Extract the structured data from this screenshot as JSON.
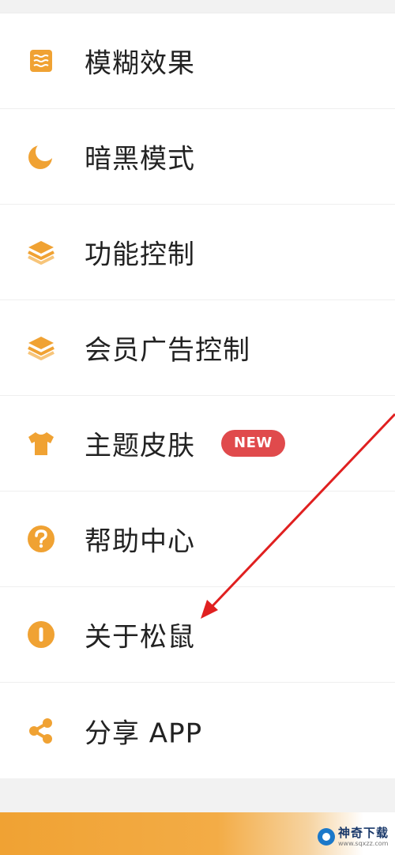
{
  "menu": {
    "items": [
      {
        "label": "模糊效果",
        "icon": "blur-icon"
      },
      {
        "label": "暗黑模式",
        "icon": "moon-icon"
      },
      {
        "label": "功能控制",
        "icon": "layers-icon"
      },
      {
        "label": "会员广告控制",
        "icon": "layers-icon"
      },
      {
        "label": "主题皮肤",
        "icon": "tshirt-icon",
        "badge": "NEW"
      },
      {
        "label": "帮助中心",
        "icon": "question-icon"
      },
      {
        "label": "关于松鼠",
        "icon": "info-icon"
      },
      {
        "label": "分享 APP",
        "icon": "share-icon"
      }
    ]
  },
  "watermark": {
    "title": "神奇下载",
    "url": "www.sqxzz.com"
  },
  "colors": {
    "icon": "#F0A233",
    "badge": "#E04A4C",
    "arrow": "#E02020"
  }
}
